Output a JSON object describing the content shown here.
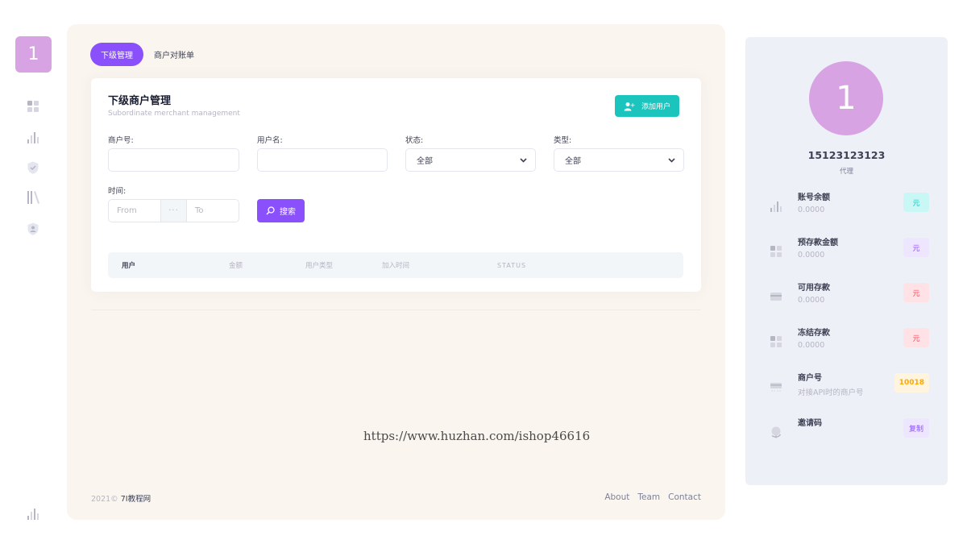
{
  "sidebar": {
    "logo": "1",
    "icons": [
      "grid-icon",
      "bar-chart-icon",
      "shield-icon",
      "library-icon",
      "badge-icon"
    ],
    "bottom_icon": "bar-chart-icon"
  },
  "tabs": [
    {
      "label": "下级管理",
      "active": true
    },
    {
      "label": "商户对账单",
      "active": false
    }
  ],
  "panel": {
    "title": "下级商户管理",
    "subtitle": "Subordinate merchant management",
    "add_user_label": "添加用户"
  },
  "filters": {
    "merchant_no_label": "商户号:",
    "merchant_no_value": "",
    "username_label": "用户名:",
    "username_value": "",
    "status_label": "状态:",
    "status_value": "全部",
    "type_label": "类型:",
    "type_value": "全部",
    "time_label": "时间:",
    "time_from_placeholder": "From",
    "time_separator": "···",
    "time_to_placeholder": "To",
    "search_label": "搜索"
  },
  "table": {
    "columns": [
      "用户",
      "金额",
      "用户类型",
      "加入时间",
      "STATUS"
    ],
    "rows": []
  },
  "watermark": "https://www.huzhan.com/ishop46616",
  "footer": {
    "year": "2021©",
    "brand": "7I教程网",
    "links": [
      "About",
      "Team",
      "Contact"
    ]
  },
  "profile": {
    "avatar": "1",
    "name": "15123123123",
    "role": "代理",
    "stats": [
      {
        "icon": "bar-chart-icon",
        "title": "账号余额",
        "value": "0.0000",
        "badge": "元",
        "badge_color": "#c9f7f5",
        "badge_text_color": "#1bc5bd"
      },
      {
        "icon": "grid-icon",
        "title": "预存款金额",
        "value": "0.0000",
        "badge": "元",
        "badge_color": "#eee5ff",
        "badge_text_color": "#8950fc"
      },
      {
        "icon": "card-icon",
        "title": "可用存款",
        "value": "0.0000",
        "badge": "元",
        "badge_color": "#ffe2e5",
        "badge_text_color": "#f64e60"
      },
      {
        "icon": "grid-icon",
        "title": "冻结存款",
        "value": "0.0000",
        "badge": "元",
        "badge_color": "#ffe2e5",
        "badge_text_color": "#f64e60"
      },
      {
        "icon": "terminal-icon",
        "title": "商户号",
        "value": "对接API时的商户号",
        "badge": "10018",
        "badge_color": "#fff4de",
        "badge_text_color": "#ffa800"
      },
      {
        "icon": "globe-icon",
        "title": "邀请码",
        "value": "",
        "badge": "复制",
        "badge_color": "#eee5ff",
        "badge_text_color": "#8950fc"
      }
    ]
  }
}
